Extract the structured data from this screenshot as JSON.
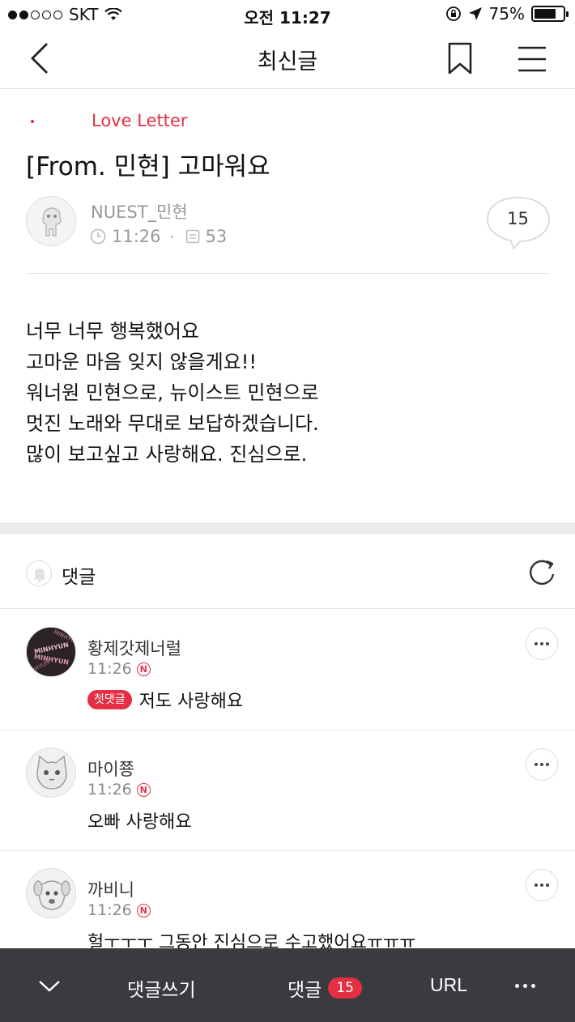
{
  "status_bar": {
    "carrier": "SKT",
    "time": "오전 11:27",
    "battery": "75%",
    "battery_level": 0.75
  },
  "nav": {
    "title": "최신글",
    "icons": [
      "back-icon",
      "bookmark-icon",
      "menu-icon"
    ]
  },
  "post": {
    "category": "Love Letter",
    "title": "[From. 민현] 고마워요",
    "author": "NUEST_민현",
    "time": "11:26",
    "views": "53",
    "comment_count": "15",
    "body_lines": [
      "너무 너무 행복했어요",
      "고마운 마음 잊지 않을게요!!",
      "워너원 민현으로, 뉴이스트 민현으로",
      "멋진 노래와 무대로 보답하겠습니다.",
      "많이 보고싶고 사랑해요. 진심으로."
    ]
  },
  "comments_section": {
    "title": "댓글",
    "items": [
      {
        "author": "황제갓제너럴",
        "time": "11:26",
        "badge": "N",
        "first_label": "첫댓글",
        "text": "저도 사랑해요"
      },
      {
        "author": "마이쭁",
        "time": "11:26",
        "badge": "N",
        "text": "오빠 사랑해요"
      },
      {
        "author": "까비니",
        "time": "11:26",
        "badge": "N",
        "text": "헐ㅜㅜㅜ 그동안 진심으로 수고했어요ㅠㅠㅠ"
      }
    ]
  },
  "avatar_text": "MINHYUN",
  "bottom_bar": {
    "write_label": "댓글쓰기",
    "comments_label": "댓글",
    "comments_count": "15",
    "url_label": "URL"
  },
  "colors": {
    "accent": "#e53043",
    "bottom_bar": "#3a3b3f"
  }
}
